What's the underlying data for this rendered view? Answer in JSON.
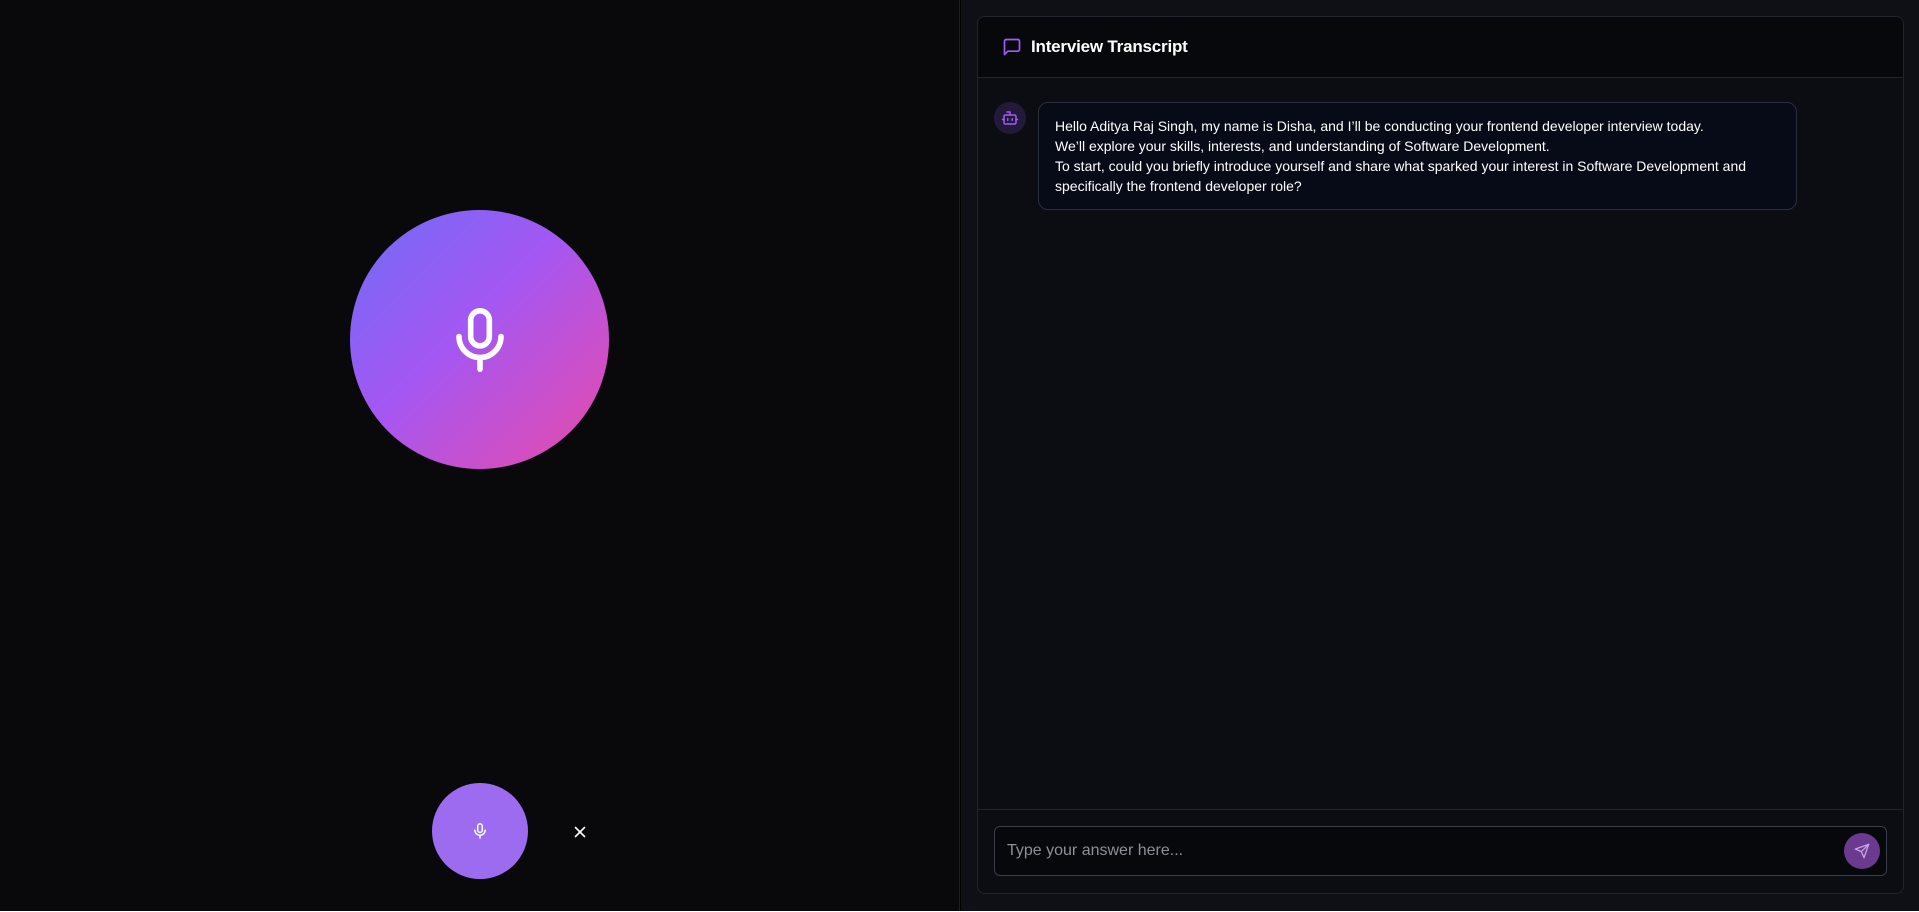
{
  "app": {
    "colors": {
      "orb_gradient": [
        "#6f6cf7",
        "#a457f2",
        "#cf4fc6",
        "#e24ba0"
      ],
      "mic_button": "#9d6bf0",
      "accent": "#a25cf5",
      "send_button": "#6a3a8f"
    }
  },
  "voice_panel": {
    "orb_icon": "microphone-icon",
    "mic_button_icon": "microphone-icon",
    "close_icon": "close-icon"
  },
  "transcript": {
    "header_icon": "message-square-icon",
    "title": "Interview Transcript",
    "messages": [
      {
        "sender_icon": "bot-icon",
        "lines": [
          "Hello Aditya Raj Singh, my name is Disha, and I’ll be conducting your frontend developer interview today.",
          "We’ll explore your skills, interests, and understanding of Software Development.",
          "To start, could you briefly introduce yourself and share what sparked your interest in Software Development and specifically the frontend developer role?"
        ]
      }
    ],
    "input": {
      "placeholder": "Type your answer here...",
      "value": "",
      "send_icon": "send-icon"
    }
  }
}
